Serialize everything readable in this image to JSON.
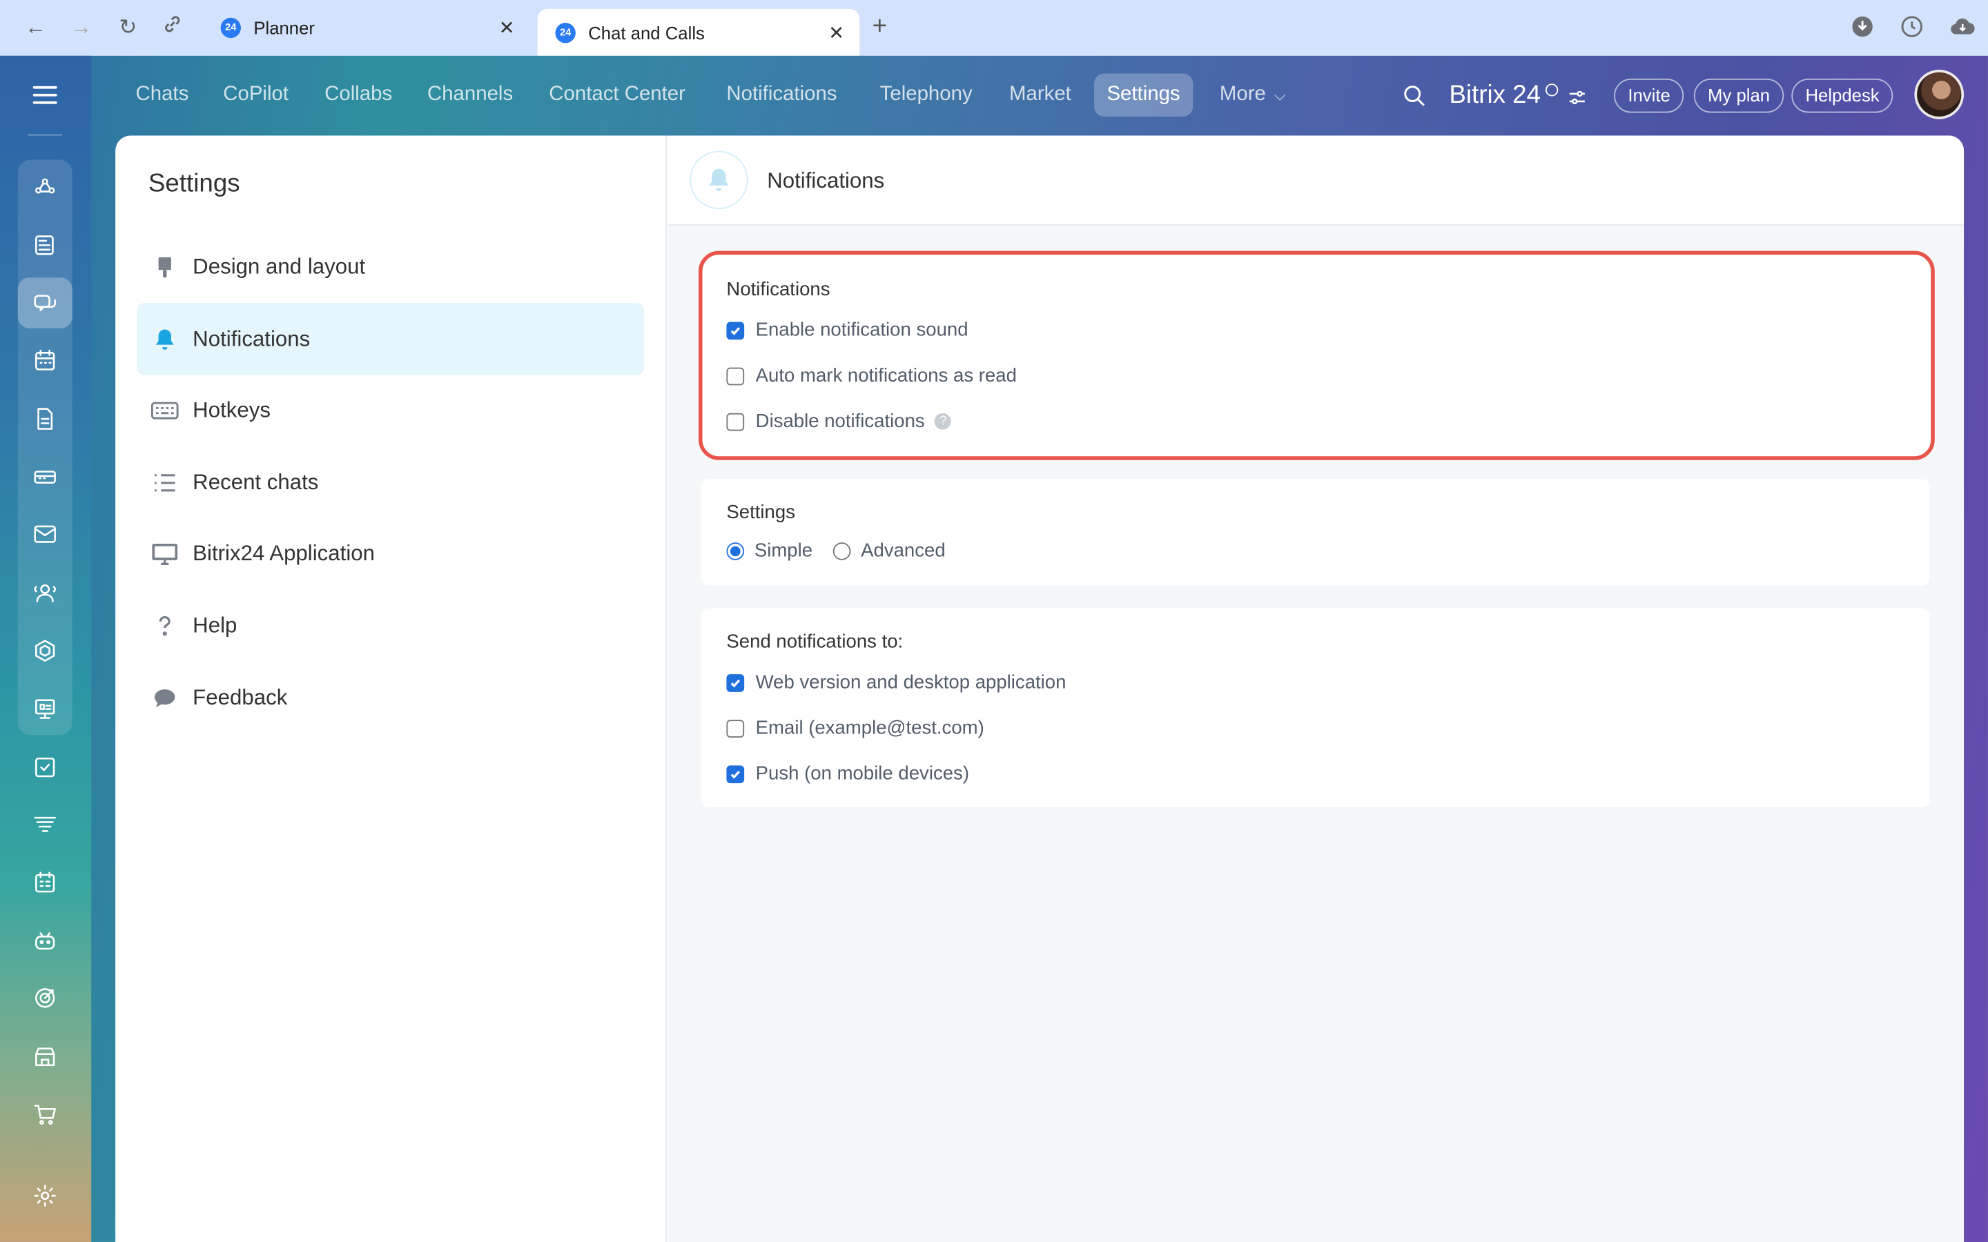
{
  "browser": {
    "tabs": [
      {
        "title": "Planner",
        "favicon": "24"
      },
      {
        "title": "Chat and Calls",
        "favicon": "24"
      }
    ],
    "close_glyph": "✕",
    "new_tab_glyph": "+"
  },
  "topnav": {
    "items": [
      "Chats",
      "CoPilot",
      "Collabs",
      "Channels",
      "Contact Center",
      "Notifications",
      "Telephony",
      "Market",
      "Settings",
      "More"
    ],
    "active": "Settings",
    "more_chevron": "⌵",
    "brand": "Bitrix 24",
    "buttons": [
      "Invite",
      "My plan",
      "Helpdesk"
    ]
  },
  "sidebar": {
    "title": "Settings",
    "items": [
      {
        "label": "Design and layout",
        "icon": "brush-icon"
      },
      {
        "label": "Notifications",
        "icon": "bell-icon",
        "active": true
      },
      {
        "label": "Hotkeys",
        "icon": "keyboard-icon"
      },
      {
        "label": "Recent chats",
        "icon": "list-icon"
      },
      {
        "label": "Bitrix24 Application",
        "icon": "monitor-icon"
      },
      {
        "label": "Help",
        "icon": "question-icon"
      },
      {
        "label": "Feedback",
        "icon": "speech-bubble-icon"
      }
    ]
  },
  "content": {
    "title": "Notifications",
    "notifications_card": {
      "title": "Notifications",
      "options": [
        {
          "label": "Enable notification sound",
          "checked": true
        },
        {
          "label": "Auto mark notifications as read",
          "checked": false
        },
        {
          "label": "Disable notifications",
          "checked": false,
          "help": "?"
        }
      ]
    },
    "settings_card": {
      "title": "Settings",
      "options": [
        {
          "label": "Simple",
          "selected": true
        },
        {
          "label": "Advanced",
          "selected": false
        }
      ]
    },
    "send_card": {
      "title": "Send notifications to:",
      "options": [
        {
          "label": "Web version and desktop application",
          "checked": true
        },
        {
          "label": "Email (example@test.com)",
          "checked": false
        },
        {
          "label": "Push (on mobile devices)",
          "checked": true
        }
      ]
    }
  },
  "colors": {
    "accent": "#1f6fdd",
    "highlight": "#e8534b",
    "active_sidebar": "#e5f6fc"
  }
}
